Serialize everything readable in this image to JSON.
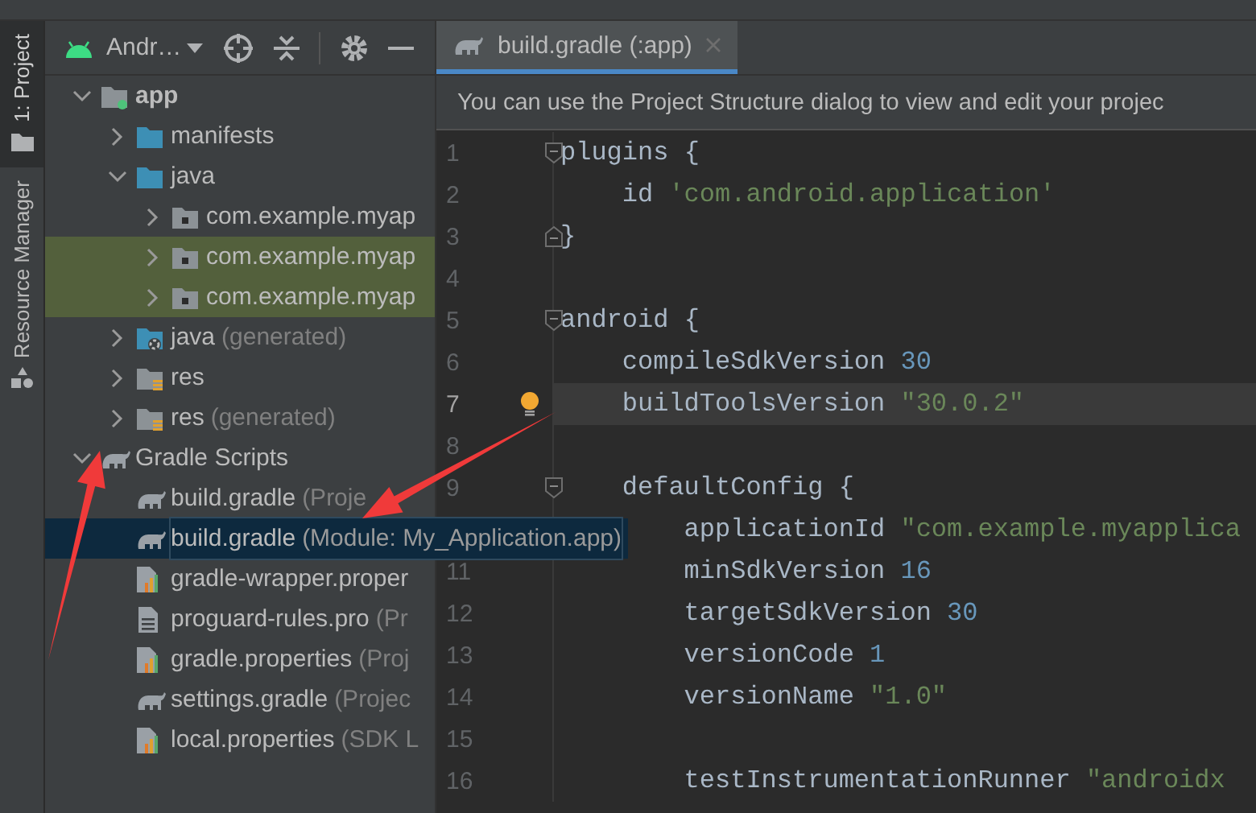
{
  "side_stripe": {
    "tabs": [
      {
        "label": "1: Project",
        "kind": "folder",
        "selected": true
      },
      {
        "label": "Resource Manager",
        "kind": "shapes",
        "selected": false
      }
    ]
  },
  "project_panel": {
    "view_selector": "Andr…",
    "tree": [
      {
        "name": "app",
        "kind": "module",
        "expanded": true,
        "selected": false,
        "highlighted": false,
        "children": [
          {
            "name": "manifests",
            "kind": "folder",
            "expanded": false,
            "selected": false,
            "highlighted": false
          },
          {
            "name": "java",
            "kind": "folder",
            "expanded": true,
            "selected": false,
            "highlighted": false,
            "children": [
              {
                "name": "com.example.myap",
                "kind": "package",
                "expanded": false,
                "selected": false,
                "highlighted": false
              },
              {
                "name": "com.example.myap",
                "kind": "package",
                "expanded": false,
                "selected": false,
                "highlighted": true
              },
              {
                "name": "com.example.myap",
                "kind": "package",
                "expanded": false,
                "selected": false,
                "highlighted": true
              }
            ]
          },
          {
            "name": "java",
            "hint": "(generated)",
            "kind": "generated-folder",
            "expanded": false,
            "selected": false,
            "highlighted": false
          },
          {
            "name": "res",
            "kind": "resource-folder",
            "expanded": false,
            "selected": false,
            "highlighted": false
          },
          {
            "name": "res",
            "hint": "(generated)",
            "kind": "resource-folder",
            "expanded": false,
            "selected": false,
            "highlighted": false
          }
        ]
      },
      {
        "name": "Gradle Scripts",
        "kind": "gradle",
        "expanded": true,
        "selected": false,
        "highlighted": false,
        "children": [
          {
            "name": "build.gradle",
            "hint": "(Proje",
            "kind": "gradle",
            "selected": false,
            "highlighted": false
          },
          {
            "name": "build.gradle",
            "hint": "(Module: My_Application.app)",
            "kind": "gradle",
            "selected": true,
            "highlighted": false
          },
          {
            "name": "gradle-wrapper.proper",
            "kind": "properties",
            "selected": false,
            "highlighted": false
          },
          {
            "name": "proguard-rules.pro",
            "hint": "(Pr",
            "kind": "text",
            "selected": false,
            "highlighted": false
          },
          {
            "name": "gradle.properties",
            "hint": "(Proj",
            "kind": "properties",
            "selected": false,
            "highlighted": false
          },
          {
            "name": "settings.gradle",
            "hint": "(Projec",
            "kind": "gradle",
            "selected": false,
            "highlighted": false
          },
          {
            "name": "local.properties",
            "hint": "(SDK L",
            "kind": "properties",
            "selected": false,
            "highlighted": false
          }
        ]
      }
    ]
  },
  "editor": {
    "tabs": [
      {
        "label": "build.gradle (:app)",
        "selected": true
      }
    ],
    "banner": "You can use the Project Structure dialog to view and edit your projec",
    "lines": [
      {
        "num": "1",
        "fold_end": false,
        "current": false,
        "bulb": false,
        "tokens": [
          {
            "kind": "plain",
            "text": "plugins {"
          }
        ],
        "children": [
          {
            "num": "2",
            "fold_end": false,
            "current": false,
            "bulb": false,
            "tokens": [
              {
                "kind": "plain",
                "text": "id "
              },
              {
                "kind": "string",
                "text": "'com.android.application'"
              }
            ]
          }
        ]
      },
      {
        "num": "3",
        "fold_end": true,
        "current": false,
        "bulb": false,
        "tokens": [
          {
            "kind": "plain",
            "text": "}"
          }
        ]
      },
      {
        "num": "4",
        "fold_end": false,
        "current": false,
        "bulb": false
      },
      {
        "num": "5",
        "fold_end": false,
        "current": false,
        "bulb": false,
        "tokens": [
          {
            "kind": "plain",
            "text": "android {"
          }
        ],
        "children": [
          {
            "num": "6",
            "fold_end": false,
            "current": false,
            "bulb": false,
            "tokens": [
              {
                "kind": "plain",
                "text": "compileSdkVersion "
              },
              {
                "kind": "number",
                "text": "30"
              }
            ]
          },
          {
            "num": "7",
            "fold_end": false,
            "current": true,
            "bulb": true,
            "tokens": [
              {
                "kind": "plain",
                "text": "buildToolsVersion "
              },
              {
                "kind": "string",
                "text": "\"30.0.2\""
              }
            ]
          },
          {
            "num": "8",
            "fold_end": false,
            "current": false,
            "bulb": false
          },
          {
            "num": "9",
            "fold_end": false,
            "current": false,
            "bulb": false,
            "tokens": [
              {
                "kind": "plain",
                "text": "defaultConfig {"
              }
            ],
            "children": [
              {
                "current": false,
                "tokens": [
                  {
                    "kind": "plain",
                    "text": "applicationId "
                  },
                  {
                    "kind": "string",
                    "text": "\"com.example.myapplica"
                  }
                ]
              },
              {
                "num": "11",
                "fold_end": false,
                "current": false,
                "bulb": false,
                "tokens": [
                  {
                    "kind": "plain",
                    "text": "minSdkVersion "
                  },
                  {
                    "kind": "number",
                    "text": "16"
                  }
                ]
              },
              {
                "num": "12",
                "fold_end": false,
                "current": false,
                "bulb": false,
                "tokens": [
                  {
                    "kind": "plain",
                    "text": "targetSdkVersion "
                  },
                  {
                    "kind": "number",
                    "text": "30"
                  }
                ]
              },
              {
                "num": "13",
                "fold_end": false,
                "current": false,
                "bulb": false,
                "tokens": [
                  {
                    "kind": "plain",
                    "text": "versionCode "
                  },
                  {
                    "kind": "number",
                    "text": "1"
                  }
                ]
              },
              {
                "num": "14",
                "fold_end": false,
                "current": false,
                "bulb": false,
                "tokens": [
                  {
                    "kind": "plain",
                    "text": "versionName "
                  },
                  {
                    "kind": "string",
                    "text": "\"1.0\""
                  }
                ]
              },
              {
                "num": "15",
                "fold_end": false,
                "current": false,
                "bulb": false
              },
              {
                "num": "16",
                "fold_end": false,
                "current": false,
                "bulb": false,
                "tokens": [
                  {
                    "kind": "plain",
                    "text": "testInstrumentationRunner "
                  },
                  {
                    "kind": "string",
                    "text": "\"androidx"
                  }
                ]
              }
            ]
          }
        ]
      }
    ]
  },
  "annotations": [
    {
      "kind": "arrow"
    },
    {
      "kind": "arrow"
    }
  ]
}
